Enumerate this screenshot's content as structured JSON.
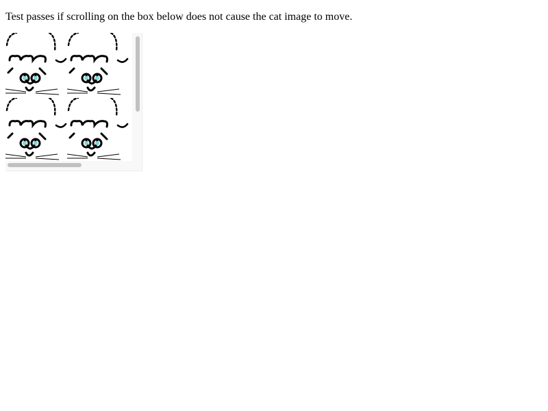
{
  "instruction": {
    "text": "Test passes if scrolling on the box below does not cause the cat image to move."
  },
  "scroll_box": {
    "background_image_icon": "cat-face-icon",
    "scrollbars": {
      "vertical": "visible",
      "horizontal": "visible"
    }
  },
  "colors": {
    "cat_line": "#000000",
    "cat_eye": "#7fd8d8",
    "scrollbar_thumb": "#c1c1c1",
    "box_background": "#f8f8f8"
  }
}
